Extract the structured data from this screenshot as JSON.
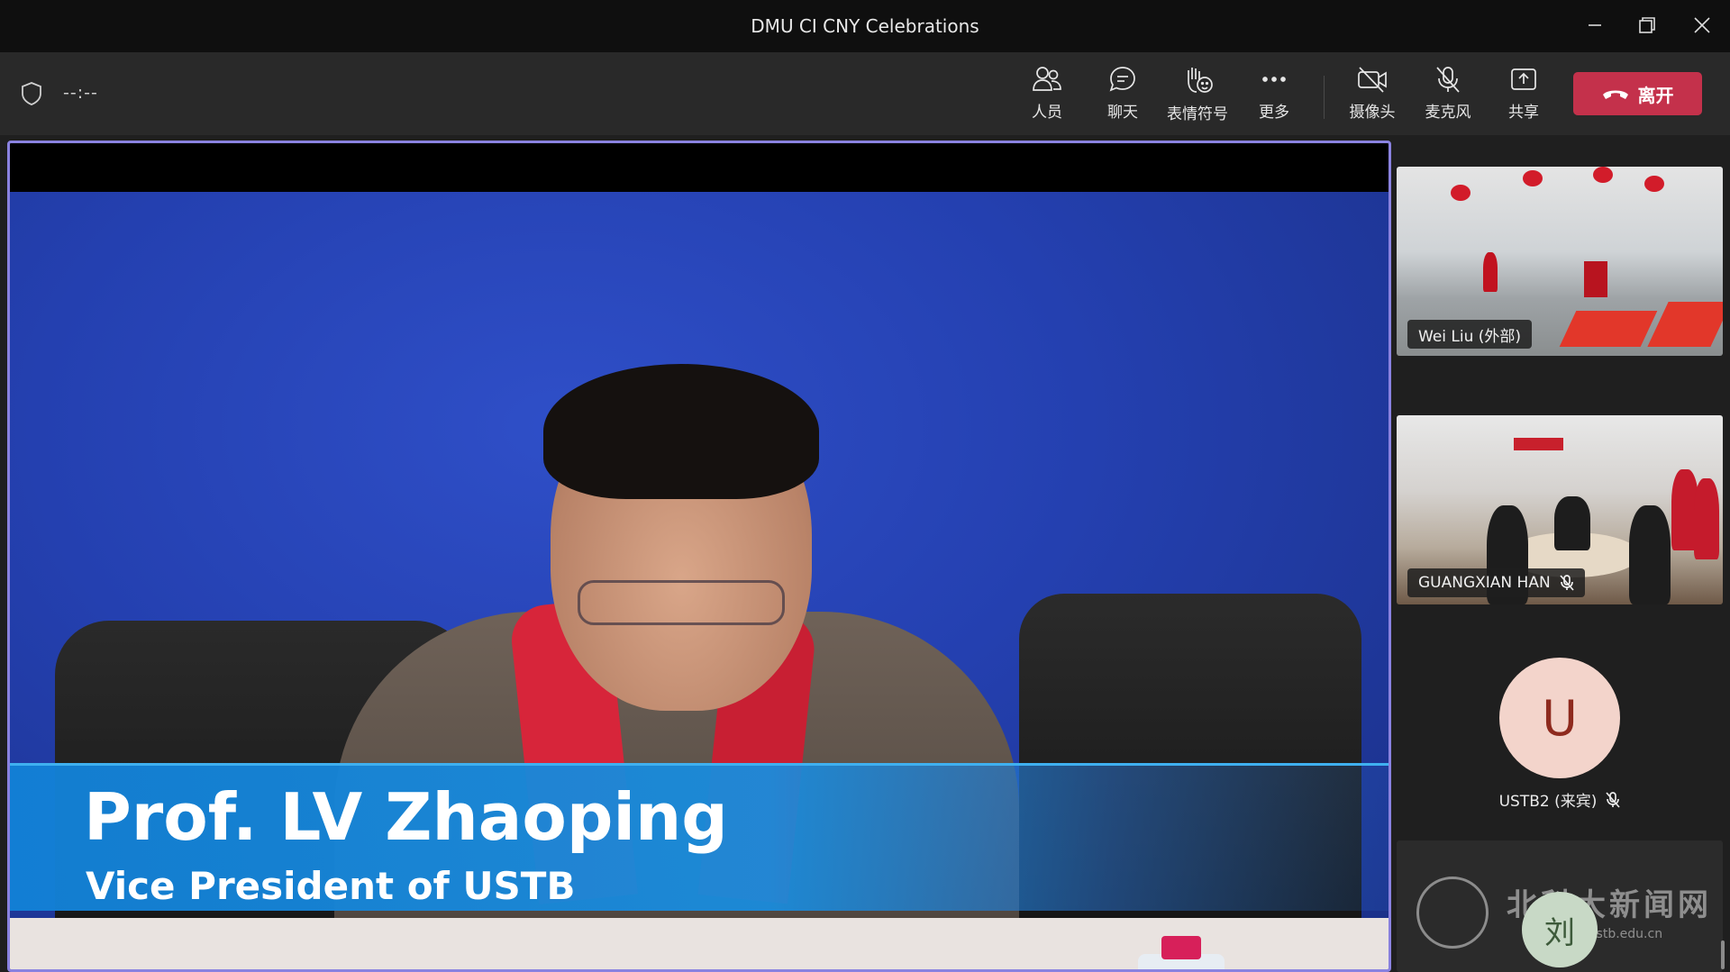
{
  "window": {
    "title": "DMU CI CNY Celebrations"
  },
  "toolbar": {
    "timer": "--:--",
    "buttons": {
      "people": "人员",
      "chat": "聊天",
      "reactions": "表情符号",
      "more": "更多",
      "camera": "摄像头",
      "mic": "麦克风",
      "share": "共享"
    },
    "leave_label": "离开"
  },
  "stage": {
    "speaker_name": "Prof. LV Zhaoping",
    "speaker_title": "Vice President of USTB"
  },
  "participants": [
    {
      "name": "Wei Liu (外部)",
      "muted": false
    },
    {
      "name": "GUANGXIAN HAN",
      "muted": true
    },
    {
      "name": "USTB2 (来宾)",
      "initial": "U",
      "muted": true
    },
    {
      "initial": "刘"
    }
  ],
  "watermark": {
    "text": "北科大新闻网",
    "url": "news.ustb.edu.cn"
  },
  "colors": {
    "leave": "#c4314b",
    "stage_border": "#8a82e0",
    "avatar_u_bg": "#f3d4cb",
    "avatar_liu_bg": "#c8d9c6"
  }
}
